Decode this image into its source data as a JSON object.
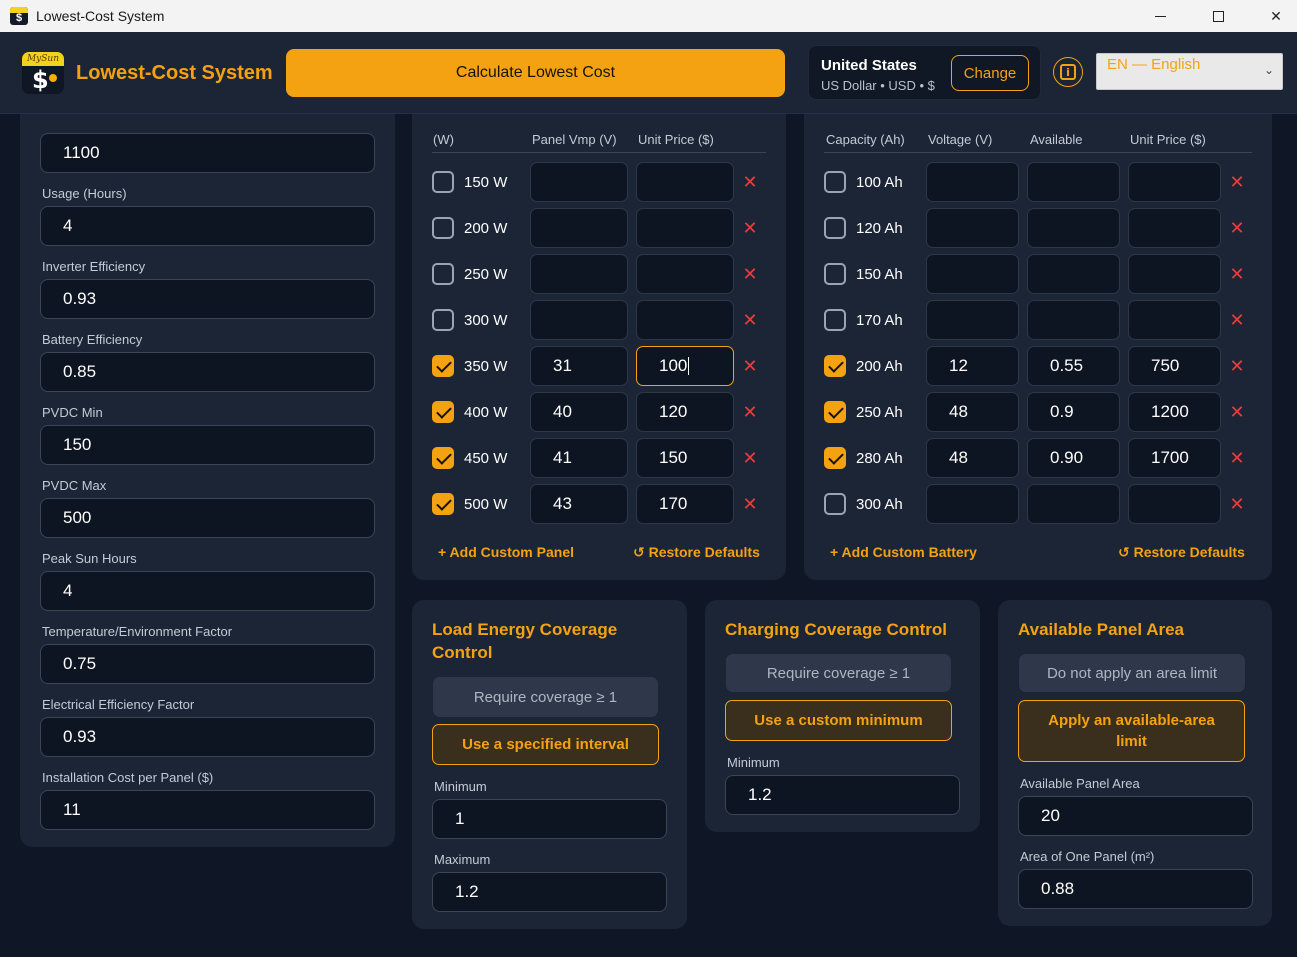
{
  "window": {
    "title": "Lowest-Cost System",
    "minimize": "",
    "maximize": "",
    "close": "✕"
  },
  "header": {
    "logo_cap": "MySun",
    "logo_symbol": "$",
    "brand": "Lowest-Cost System",
    "calculate_label": "Calculate Lowest Cost",
    "country_name": "United States",
    "country_sub": "US Dollar • USD • $",
    "change_label": "Change",
    "info_icon": "i",
    "language": "EN — English",
    "language_caret": "⌄"
  },
  "colors": {
    "accent": "#f4a211",
    "danger": "#ef3b3b",
    "background": "#0f1726",
    "card": "#1c2535"
  },
  "left_fields": [
    {
      "label": "",
      "value": "1100"
    },
    {
      "label": "Usage (Hours)",
      "value": "4"
    },
    {
      "label": "Inverter Efficiency",
      "value": "0.93"
    },
    {
      "label": "Battery Efficiency",
      "value": "0.85"
    },
    {
      "label": "PVDC Min",
      "value": "150"
    },
    {
      "label": "PVDC Max",
      "value": "500"
    },
    {
      "label": "Peak Sun Hours",
      "value": "4"
    },
    {
      "label": "Temperature/Environment Factor",
      "value": "0.75"
    },
    {
      "label": "Electrical Efficiency Factor",
      "value": "0.93"
    },
    {
      "label": "Installation Cost per Panel ($)",
      "value": "11"
    }
  ],
  "panels": {
    "headers": [
      "(W)",
      "Panel Vmp (V)",
      "Unit Price ($)"
    ],
    "rows": [
      {
        "checked": false,
        "label": "150 W",
        "vmp": "",
        "price": ""
      },
      {
        "checked": false,
        "label": "200 W",
        "vmp": "",
        "price": ""
      },
      {
        "checked": false,
        "label": "250 W",
        "vmp": "",
        "price": ""
      },
      {
        "checked": false,
        "label": "300 W",
        "vmp": "",
        "price": ""
      },
      {
        "checked": true,
        "label": "350 W",
        "vmp": "31",
        "price": "100"
      },
      {
        "checked": true,
        "label": "400 W",
        "vmp": "40",
        "price": "120"
      },
      {
        "checked": true,
        "label": "450 W",
        "vmp": "41",
        "price": "150"
      },
      {
        "checked": true,
        "label": "500 W",
        "vmp": "43",
        "price": "170"
      }
    ],
    "add_label": "+ Add Custom Panel",
    "restore_label": "↺ Restore Defaults",
    "delete_glyph": "✕"
  },
  "batteries": {
    "headers": [
      "Capacity (Ah)",
      "Voltage (V)",
      "Available",
      "Unit Price ($)"
    ],
    "rows": [
      {
        "checked": false,
        "label": "100 Ah",
        "voltage": "",
        "available": "",
        "price": ""
      },
      {
        "checked": false,
        "label": "120 Ah",
        "voltage": "",
        "available": "",
        "price": ""
      },
      {
        "checked": false,
        "label": "150 Ah",
        "voltage": "",
        "available": "",
        "price": ""
      },
      {
        "checked": false,
        "label": "170 Ah",
        "voltage": "",
        "available": "",
        "price": ""
      },
      {
        "checked": true,
        "label": "200 Ah",
        "voltage": "12",
        "available": "0.55",
        "price": "750"
      },
      {
        "checked": true,
        "label": "250 Ah",
        "voltage": "48",
        "available": "0.9",
        "price": "1200"
      },
      {
        "checked": true,
        "label": "280 Ah",
        "voltage": "48",
        "available": "0.90",
        "price": "1700"
      },
      {
        "checked": false,
        "label": "300 Ah",
        "voltage": "",
        "available": "",
        "price": ""
      }
    ],
    "add_label": "+ Add Custom Battery",
    "restore_label": "↺ Restore Defaults",
    "delete_glyph": "✕"
  },
  "load_coverage": {
    "title": "Load Energy Coverage Control",
    "option_default": "Require coverage ≥ 1",
    "option_selected": "Use a specified interval",
    "min_label": "Minimum",
    "min_value": "1",
    "max_label": "Maximum",
    "max_value": "1.2"
  },
  "charging_coverage": {
    "title": "Charging Coverage Control",
    "option_default": "Require coverage ≥ 1",
    "option_selected": "Use a custom minimum",
    "min_label": "Minimum",
    "min_value": "1.2"
  },
  "panel_area": {
    "title": "Available Panel Area",
    "option_default": "Do not apply an area limit",
    "option_selected": "Apply an available-area limit",
    "area_label": "Available Panel Area",
    "area_value": "20",
    "one_panel_label": "Area of One Panel (m²)",
    "one_panel_value": "0.88"
  }
}
